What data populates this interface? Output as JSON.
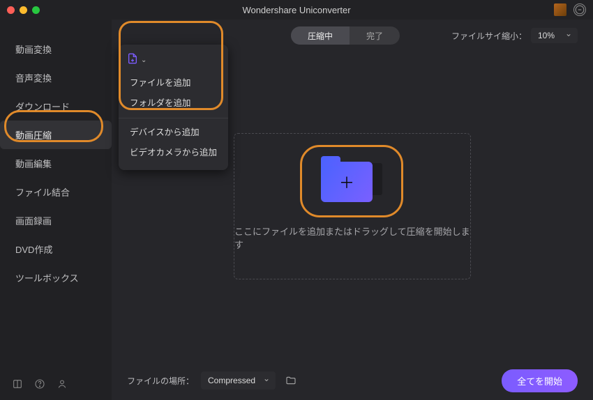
{
  "window": {
    "title": "Wondershare Uniconverter"
  },
  "sidebar": {
    "items": [
      {
        "label": "動画変換"
      },
      {
        "label": "音声変換"
      },
      {
        "label": "ダウンロード"
      },
      {
        "label": "動画圧縮"
      },
      {
        "label": "動画編集"
      },
      {
        "label": "ファイル結合"
      },
      {
        "label": "画面録画"
      },
      {
        "label": "DVD作成"
      },
      {
        "label": "ツールボックス"
      }
    ]
  },
  "toolbar": {
    "segments": {
      "inprogress": "圧縮中",
      "done": "完了"
    },
    "ratio_label": "ファイルサイ縮小：",
    "ratio_value": "10%"
  },
  "add_menu": {
    "group1": {
      "a": "ファイルを追加",
      "b": "フォルダを追加"
    },
    "group2": {
      "a": "デバイスから追加",
      "b": "ビデオカメラから追加"
    }
  },
  "dropzone": {
    "text": "ここにファイルを追加またはドラッグして圧縮を開始します"
  },
  "bottom": {
    "location_label": "ファイルの場所：",
    "location_value": "Compressed",
    "start_label": "全てを開始"
  }
}
